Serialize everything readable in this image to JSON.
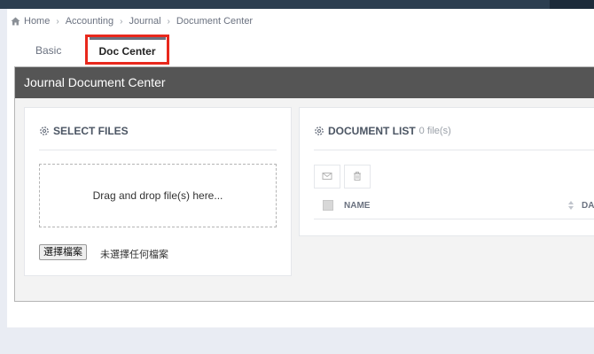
{
  "breadcrumb": {
    "items": [
      "Home",
      "Accounting",
      "Journal",
      "Document Center"
    ]
  },
  "tabs": [
    {
      "label": "Basic"
    },
    {
      "label": "Doc Center"
    }
  ],
  "panel": {
    "title": "Journal Document Center"
  },
  "select_files": {
    "title": "SELECT FILES",
    "dropzone_text": "Drag and drop file(s) here...",
    "choose_button": "選擇檔案",
    "no_file_text": "未選擇任何檔案"
  },
  "document_list": {
    "title": "DOCUMENT LIST",
    "count": "0 file(s)",
    "columns": [
      "NAME",
      "DA"
    ]
  },
  "colors": {
    "accent_highlight": "#e8281c",
    "panel_header": "#555555",
    "topbar": "#2c3e50"
  }
}
